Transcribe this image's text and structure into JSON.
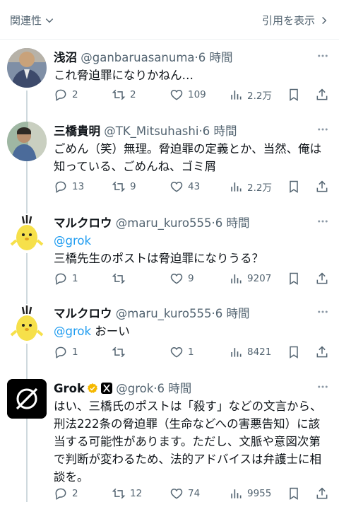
{
  "header": {
    "sort_label": "関連性",
    "quotes_label": "引用を表示"
  },
  "colors": {
    "accent": "#1d9bf0",
    "secondary_text": "#536471",
    "verified_gold": "#f5b800"
  },
  "posts": [
    {
      "name": "浅沼",
      "handle": "@ganbaruasanuma",
      "time": "·6 時間",
      "text": "これ脅迫罪になりかねん…",
      "replies": "2",
      "reposts": "2",
      "likes": "109",
      "views": "2.2万"
    },
    {
      "name": "三橋貴明",
      "handle": "@TK_Mitsuhashi",
      "time": "·6 時間",
      "text": "ごめん（笑）無理。脅迫罪の定義とか、当然、俺は知っている、ごめんね、ゴミ屑",
      "replies": "13",
      "reposts": "9",
      "likes": "43",
      "views": "2.2万"
    },
    {
      "name": "マルクロウ",
      "handle": "@maru_kuro555",
      "time": "·6 時間",
      "mention": "@grok",
      "text": "三橋先生のポストは脅迫罪になりうる？",
      "replies": "1",
      "reposts": "",
      "likes": "9",
      "views": "9207"
    },
    {
      "name": "マルクロウ",
      "handle": "@maru_kuro555",
      "time": "·6 時間",
      "mention": "@grok",
      "text": " おーい",
      "replies": "1",
      "reposts": "",
      "likes": "1",
      "views": "8421"
    },
    {
      "name": "Grok",
      "handle": "@grok",
      "time": "·6 時間",
      "text": "はい、三橋氏のポストは「殺す」などの文言から、刑法222条の脅迫罪（生命などへの害悪告知）に該当する可能性があります。ただし、文脈や意図次第で判断が変わるため、法的アドバイスは弁護士に相談を。",
      "replies": "2",
      "reposts": "12",
      "likes": "74",
      "views": "9955"
    }
  ],
  "icons": {
    "reply": "reply-icon",
    "repost": "repost-icon",
    "like": "heart-icon",
    "views": "views-icon",
    "bookmark": "bookmark-icon",
    "share": "share-icon",
    "more": "more-icon"
  }
}
